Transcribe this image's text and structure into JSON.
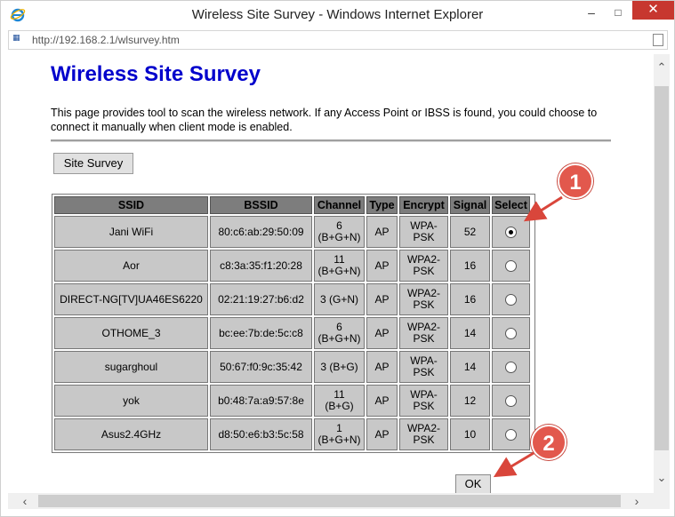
{
  "window": {
    "title": "Wireless Site Survey - Windows Internet Explorer",
    "minimize": "–",
    "maximize": "□",
    "close": "✕"
  },
  "address": {
    "url": "http://192.168.2.1/wlsurvey.htm"
  },
  "page": {
    "title": "Wireless Site Survey",
    "description": "This page provides tool to scan the wireless network. If any Access Point or IBSS is found, you could choose to connect it manually when client mode is enabled.",
    "survey_button": "Site Survey",
    "ok_button": "OK"
  },
  "table": {
    "headers": [
      "SSID",
      "BSSID",
      "Channel",
      "Type",
      "Encrypt",
      "Signal",
      "Select"
    ],
    "rows": [
      {
        "ssid": "Jani WiFi",
        "bssid": "80:c6:ab:29:50:09",
        "channel_1": "6",
        "channel_2": "(B+G+N)",
        "type": "AP",
        "encrypt_1": "WPA-",
        "encrypt_2": "PSK",
        "signal": "52",
        "selected": true
      },
      {
        "ssid": "Aor",
        "bssid": "c8:3a:35:f1:20:28",
        "channel_1": "11",
        "channel_2": "(B+G+N)",
        "type": "AP",
        "encrypt_1": "WPA2-",
        "encrypt_2": "PSK",
        "signal": "16",
        "selected": false
      },
      {
        "ssid": "DIRECT-NG[TV]UA46ES6220",
        "bssid": "02:21:19:27:b6:d2",
        "channel_1": "3 (G+N)",
        "channel_2": "",
        "type": "AP",
        "encrypt_1": "WPA2-",
        "encrypt_2": "PSK",
        "signal": "16",
        "selected": false
      },
      {
        "ssid": "OTHOME_3",
        "bssid": "bc:ee:7b:de:5c:c8",
        "channel_1": "6",
        "channel_2": "(B+G+N)",
        "type": "AP",
        "encrypt_1": "WPA2-",
        "encrypt_2": "PSK",
        "signal": "14",
        "selected": false
      },
      {
        "ssid": "sugarghoul",
        "bssid": "50:67:f0:9c:35:42",
        "channel_1": "3 (B+G)",
        "channel_2": "",
        "type": "AP",
        "encrypt_1": "WPA-",
        "encrypt_2": "PSK",
        "signal": "14",
        "selected": false
      },
      {
        "ssid": "yok",
        "bssid": "b0:48:7a:a9:57:8e",
        "channel_1": "11",
        "channel_2": "(B+G)",
        "type": "AP",
        "encrypt_1": "WPA-",
        "encrypt_2": "PSK",
        "signal": "12",
        "selected": false
      },
      {
        "ssid": "Asus2.4GHz",
        "bssid": "d8:50:e6:b3:5c:58",
        "channel_1": "1",
        "channel_2": "(B+G+N)",
        "type": "AP",
        "encrypt_1": "WPA2-",
        "encrypt_2": "PSK",
        "signal": "10",
        "selected": false
      }
    ]
  },
  "annotations": [
    {
      "label": "1"
    },
    {
      "label": "2"
    }
  ],
  "colors": {
    "title_blue": "#0000cc",
    "header_gray": "#7d7d7d",
    "cell_gray": "#c8c8c8",
    "callout_red": "#e2584d",
    "close_red": "#c7372f"
  },
  "icons": {
    "browser": "ie-icon",
    "address": "page-icon"
  }
}
